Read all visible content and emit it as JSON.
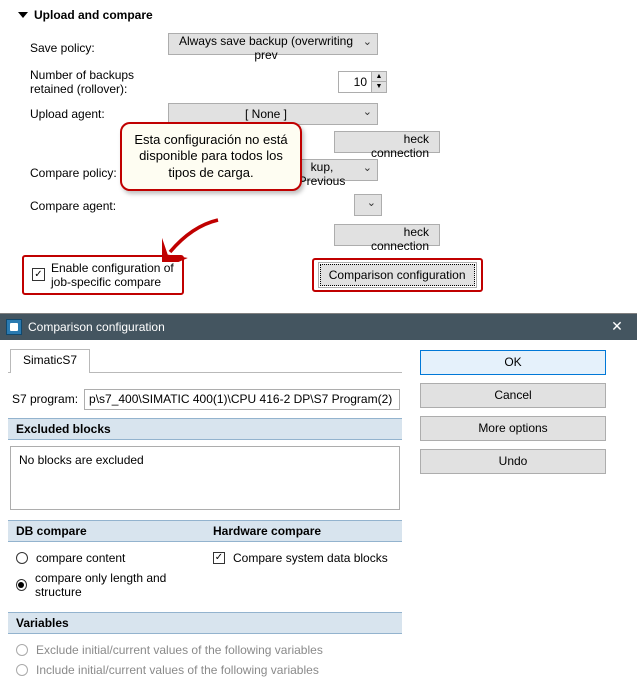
{
  "section": {
    "title": "Upload and compare"
  },
  "form": {
    "save_policy_label": "Save policy:",
    "save_policy_value": "Always save backup (overwriting prev",
    "backups_label_l1": "Number of backups",
    "backups_label_l2": "retained (rollover):",
    "backups_value": "10",
    "upload_agent_label": "Upload agent:",
    "upload_agent_value": "[ None ]",
    "compare_policy_label": "Compare policy:",
    "compare_policy_value": "kup, Previous",
    "compare_agent_label": "Compare agent:",
    "check_connection": "Check connection",
    "check_connection_trunc": "heck connection",
    "enable_cfg_l1": "Enable configuration of",
    "enable_cfg_l2": "job-specific compare",
    "comp_cfg_btn": "Comparison configuration"
  },
  "callout": {
    "text": "Esta configuración no está disponible para todos los tipos de carga."
  },
  "dialog": {
    "title": "Comparison configuration",
    "tab": "SimaticS7",
    "s7_program_label": "S7 program:",
    "s7_program_value": "p\\s7_400\\SIMATIC 400(1)\\CPU 416-2 DP\\S7 Program(2)",
    "excluded_header": "Excluded blocks",
    "excluded_msg": "No blocks are excluded",
    "db_compare_header": "DB compare",
    "hw_compare_header": "Hardware compare",
    "db_opt_content": "compare content",
    "db_opt_len": "compare only length and structure",
    "hw_opt_sys": "Compare system data blocks",
    "variables_header": "Variables",
    "var_exclude": "Exclude initial/current values of the following variables",
    "var_include": "Include initial/current values of the following variables",
    "btn_ok": "OK",
    "btn_cancel": "Cancel",
    "btn_more": "More options",
    "btn_undo": "Undo"
  }
}
